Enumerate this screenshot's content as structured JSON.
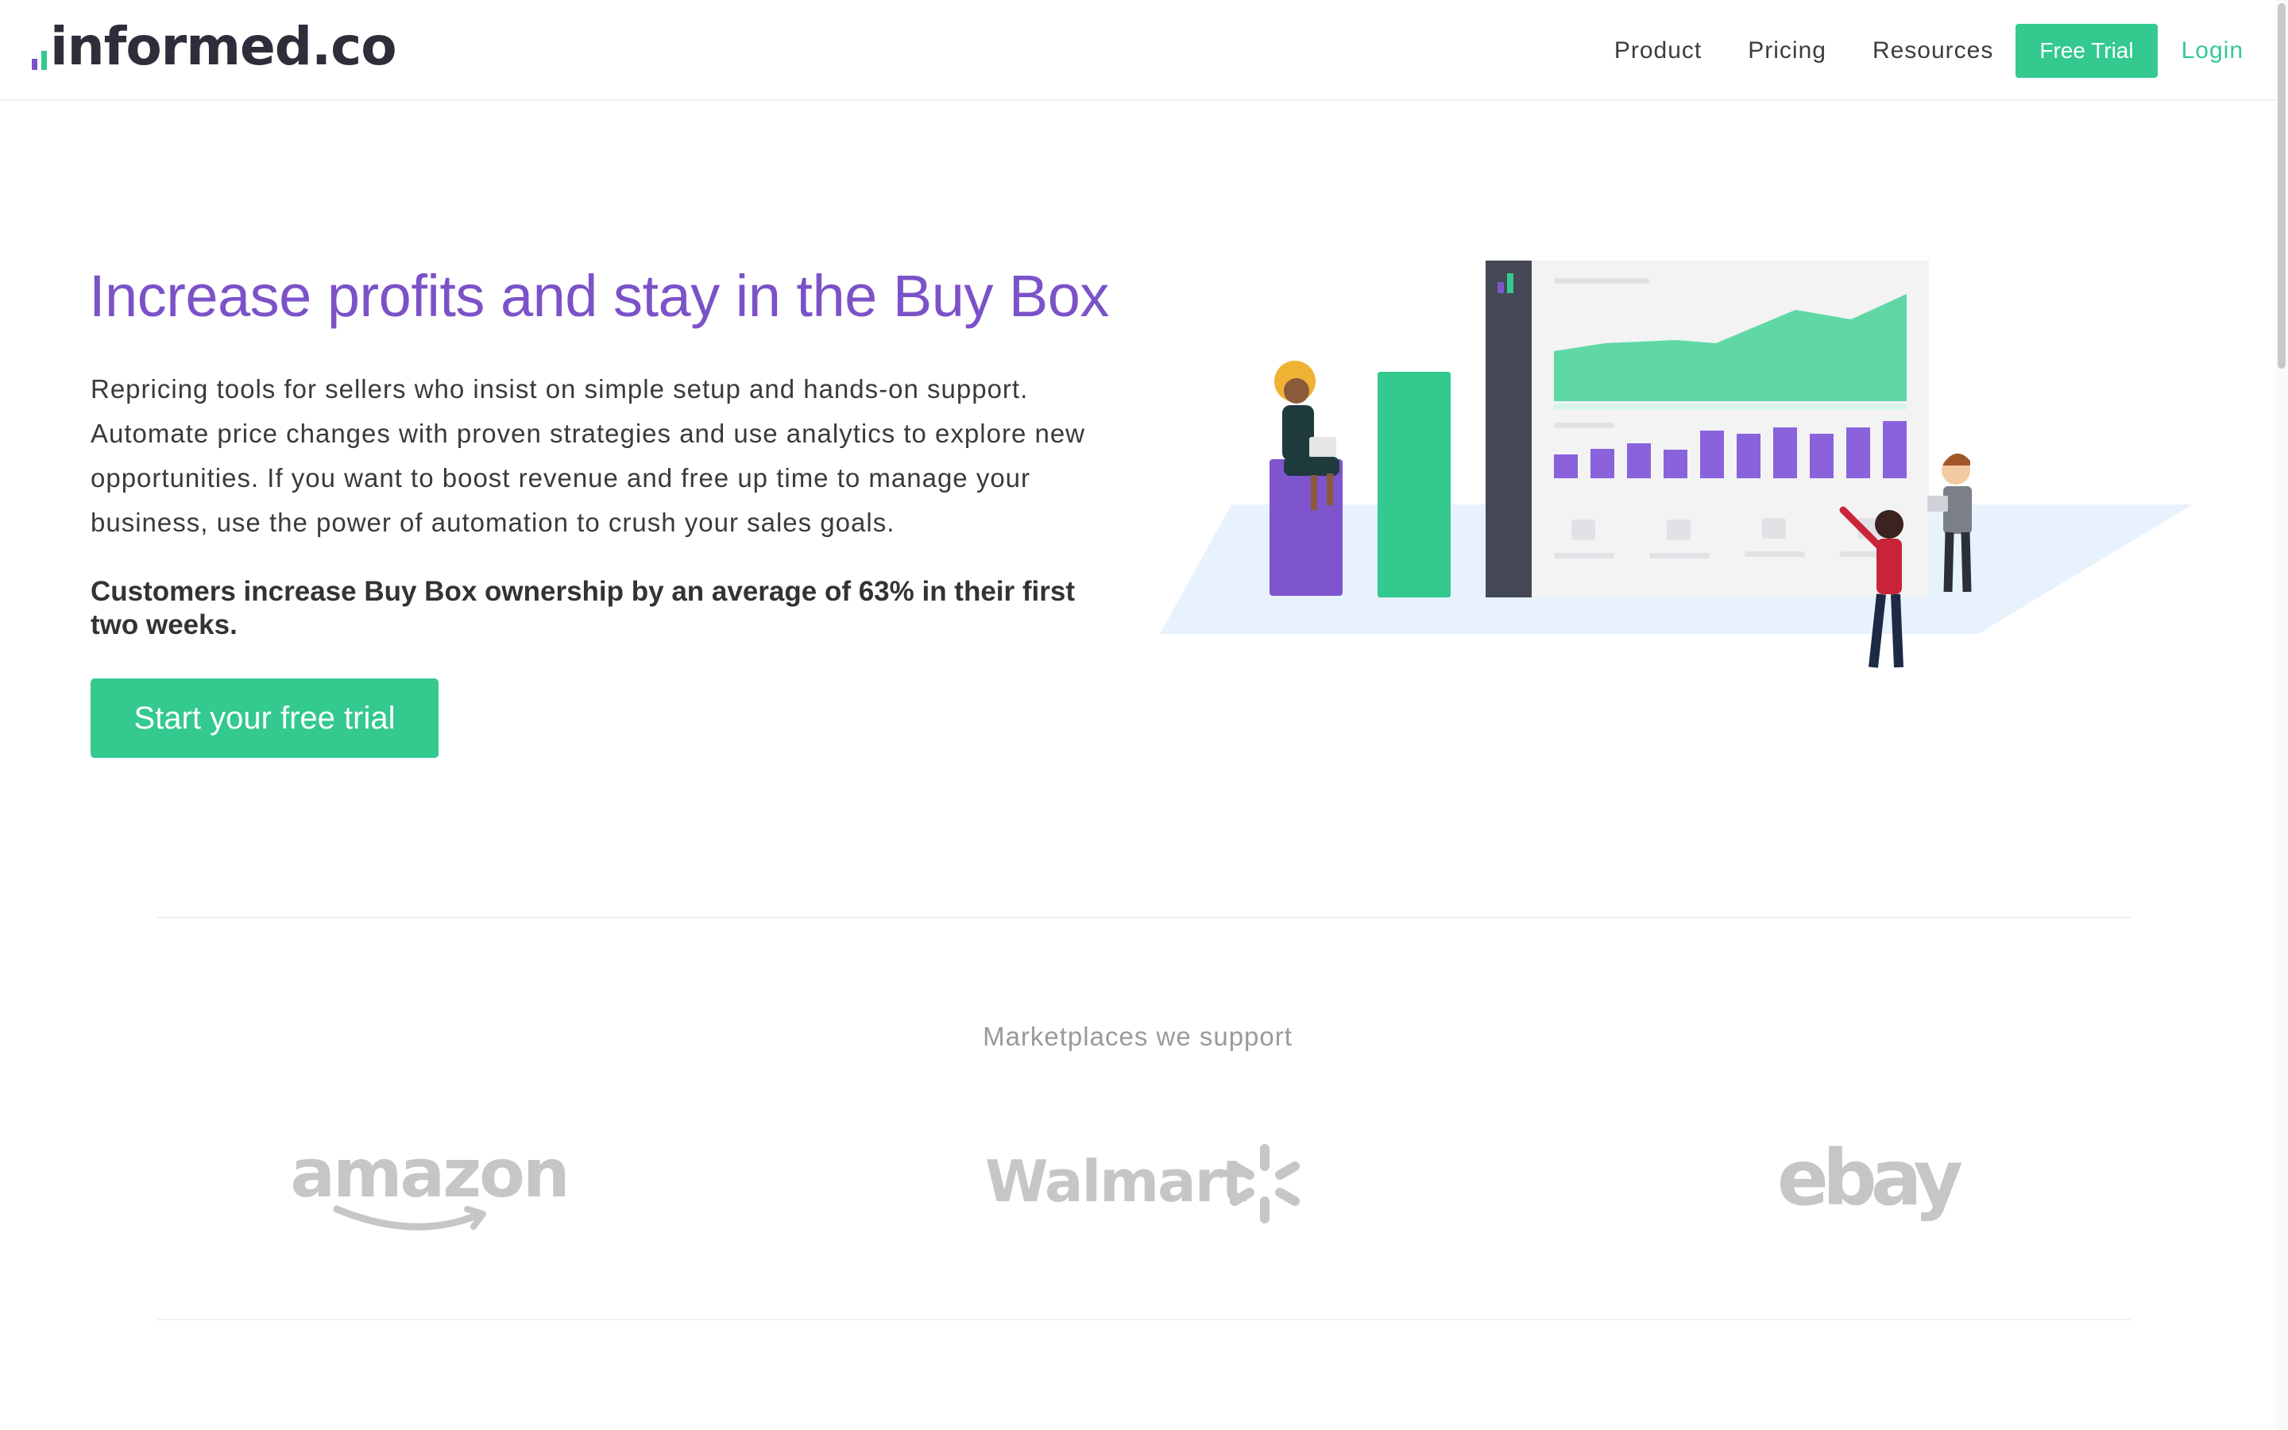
{
  "nav": {
    "logo_text": "informed.co",
    "links": [
      "Product",
      "Pricing",
      "Resources"
    ],
    "cta": "Free Trial",
    "login": "Login"
  },
  "hero": {
    "title": "Increase profits and stay in the Buy Box",
    "body": "Repricing tools for sellers who insist on simple setup and hands-on support. Automate price changes with proven strategies and use analytics to explore new opportunities. If you want to boost revenue and free up time to manage your business, use the power of automation to crush your sales goals.",
    "stat": "Customers increase Buy Box ownership by an average of 63% in their first two weeks.",
    "cta": "Start your free trial"
  },
  "marketplaces": {
    "heading": "Marketplaces we support",
    "logos": [
      "amazon",
      "Walmart",
      "ebay"
    ]
  },
  "colors": {
    "brand_green": "#33c98f",
    "brand_purple": "#7b52c8",
    "logo_gray": "#c6c6c6"
  }
}
